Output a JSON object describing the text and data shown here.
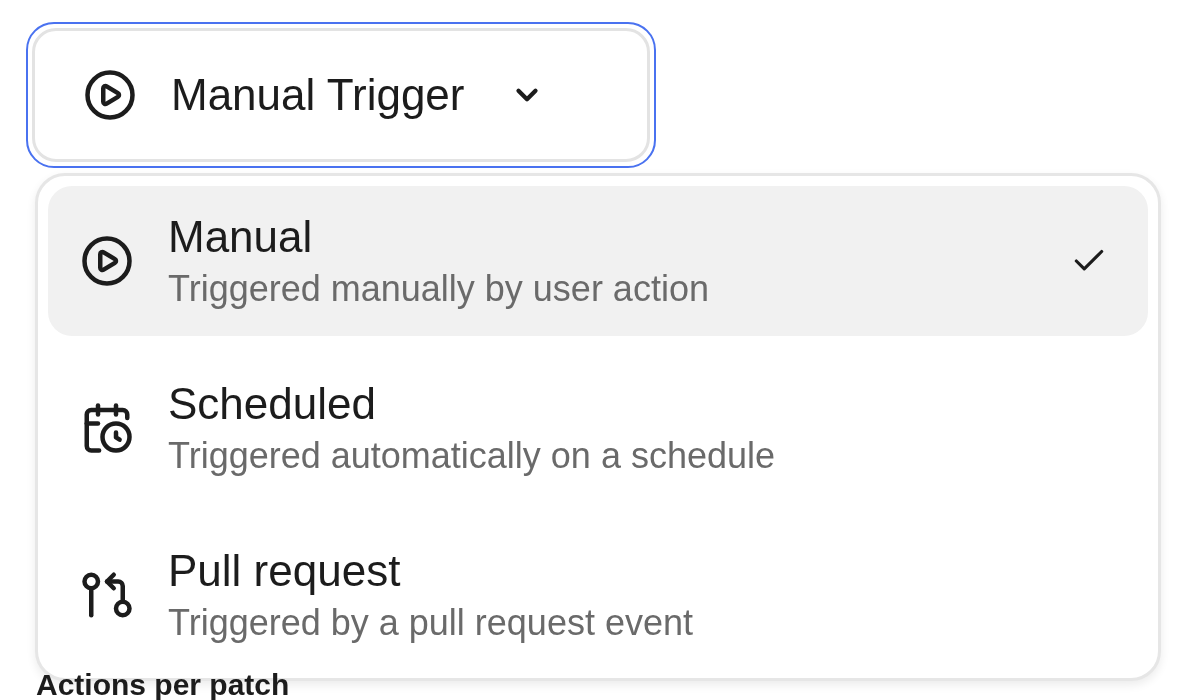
{
  "trigger": {
    "label": "Manual Trigger",
    "expanded": true
  },
  "options": [
    {
      "kind": "manual",
      "title": "Manual",
      "description": "Triggered manually by user action",
      "selected": true
    },
    {
      "kind": "scheduled",
      "title": "Scheduled",
      "description": "Triggered automatically on a schedule",
      "selected": false
    },
    {
      "kind": "pull_request",
      "title": "Pull request",
      "description": "Triggered by a pull request event",
      "selected": false
    }
  ],
  "section_label": "Actions per patch"
}
